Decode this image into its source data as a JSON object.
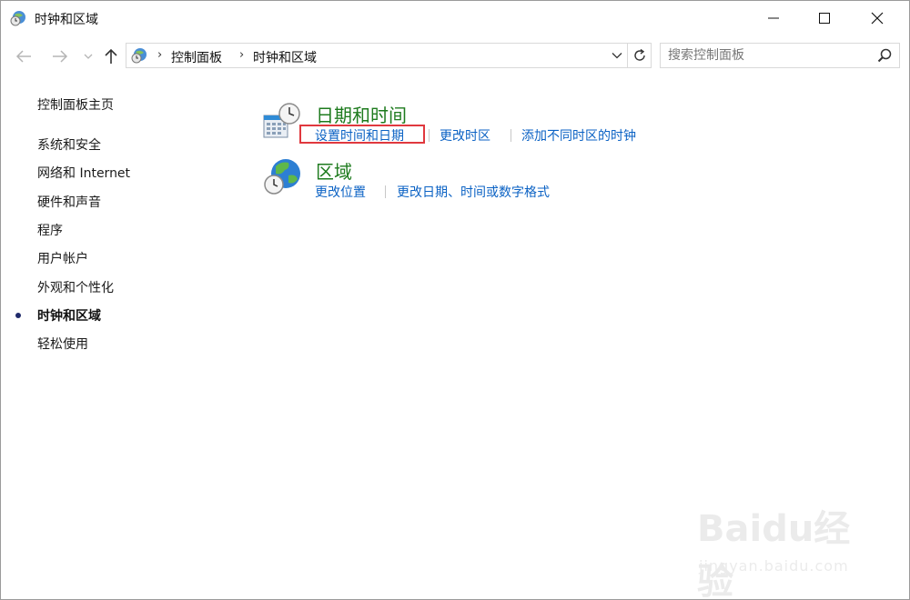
{
  "window": {
    "title": "时钟和区域",
    "icon": "control-panel-clock-icon"
  },
  "controls": {
    "minimize": "minimize-icon",
    "maximize": "maximize-icon",
    "close": "close-icon"
  },
  "address": {
    "breadcrumbs": [
      "控制面板",
      "时钟和区域"
    ]
  },
  "search": {
    "placeholder": "搜索控制面板"
  },
  "sidebar": {
    "home": "控制面板主页",
    "items": [
      {
        "label": "系统和安全",
        "current": false
      },
      {
        "label": "网络和 Internet",
        "current": false
      },
      {
        "label": "硬件和声音",
        "current": false
      },
      {
        "label": "程序",
        "current": false
      },
      {
        "label": "用户帐户",
        "current": false
      },
      {
        "label": "外观和个性化",
        "current": false
      },
      {
        "label": "时钟和区域",
        "current": true
      },
      {
        "label": "轻松使用",
        "current": false
      }
    ]
  },
  "groups": [
    {
      "title": "日期和时间",
      "icon": "date-time-icon",
      "links": [
        "设置时间和日期",
        "更改时区",
        "添加不同时区的时钟"
      ]
    },
    {
      "title": "区域",
      "icon": "region-globe-icon",
      "links": [
        "更改位置",
        "更改日期、时间或数字格式"
      ]
    }
  ],
  "colors": {
    "link": "#0b62c4",
    "group_title": "#1e7b1e",
    "highlight": "#e0383e"
  },
  "watermark": {
    "logo": "Baidu经验",
    "url": "jingyan.baidu.com"
  }
}
